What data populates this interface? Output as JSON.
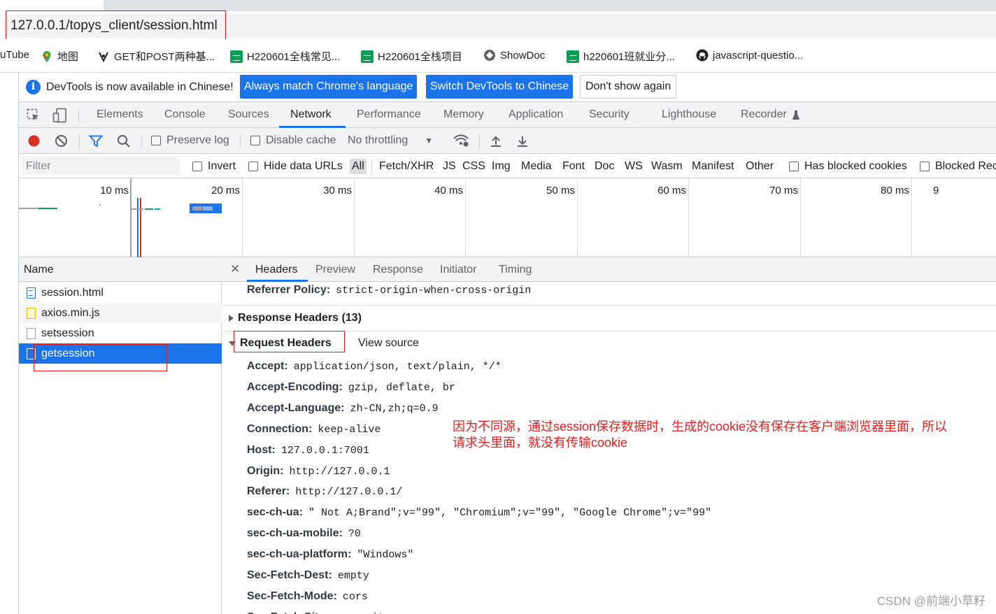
{
  "browser": {
    "url": "127.0.0.1/topys_client/session.html",
    "bookmarks": [
      {
        "label": "uTube",
        "icon": "youtube-icon"
      },
      {
        "label": "地图",
        "icon": "maps-icon"
      },
      {
        "label": "GET和POST两种基...",
        "icon": "bookmark-icon"
      },
      {
        "label": "H220601全栈常见...",
        "icon": "sheet-icon"
      },
      {
        "label": "H220601全栈项目",
        "icon": "sheet-icon"
      },
      {
        "label": "ShowDoc",
        "icon": "showdoc-icon"
      },
      {
        "label": "h220601班就业分...",
        "icon": "sheet-icon"
      },
      {
        "label": "javascript-questio...",
        "icon": "github-icon"
      }
    ]
  },
  "infobar": {
    "message": "DevTools is now available in Chinese!",
    "btn_match": "Always match Chrome's language",
    "btn_switch": "Switch DevTools to Chinese",
    "btn_dismiss": "Don't show again"
  },
  "tabs": [
    "Elements",
    "Console",
    "Sources",
    "Network",
    "Performance",
    "Memory",
    "Application",
    "Security",
    "Lighthouse",
    "Recorder"
  ],
  "active_tab": "Network",
  "toolbar": {
    "preserve_log": "Preserve log",
    "disable_cache": "Disable cache",
    "throttling": "No throttling"
  },
  "filterbar": {
    "placeholder": "Filter",
    "invert": "Invert",
    "hide_data_urls": "Hide data URLs",
    "types": [
      "All",
      "Fetch/XHR",
      "JS",
      "CSS",
      "Img",
      "Media",
      "Font",
      "Doc",
      "WS",
      "Wasm",
      "Manifest",
      "Other"
    ],
    "has_blocked_cookies": "Has blocked cookies",
    "blocked_requests": "Blocked Rec"
  },
  "timeline": {
    "labels": [
      "10 ms",
      "20 ms",
      "30 ms",
      "40 ms",
      "50 ms",
      "60 ms",
      "70 ms",
      "80 ms",
      "9"
    ]
  },
  "requests": {
    "header": "Name",
    "items": [
      {
        "name": "session.html",
        "type": "html"
      },
      {
        "name": "axios.min.js",
        "type": "js"
      },
      {
        "name": "setsession",
        "type": "xhr"
      },
      {
        "name": "getsession",
        "type": "xhr"
      }
    ],
    "selected": "getsession"
  },
  "details": {
    "tabs": [
      "Headers",
      "Preview",
      "Response",
      "Initiator",
      "Timing"
    ],
    "active_tab": "Headers",
    "referrer_policy": {
      "key": "Referrer Policy:",
      "value": "strict-origin-when-cross-origin"
    },
    "response_headers": "Response Headers (13)",
    "request_headers": "Request Headers",
    "view_source": "View source",
    "headers": [
      {
        "key": "Accept:",
        "value": "application/json, text/plain, */*"
      },
      {
        "key": "Accept-Encoding:",
        "value": "gzip, deflate, br"
      },
      {
        "key": "Accept-Language:",
        "value": "zh-CN,zh;q=0.9"
      },
      {
        "key": "Connection:",
        "value": "keep-alive"
      },
      {
        "key": "Host:",
        "value": "127.0.0.1:7001"
      },
      {
        "key": "Origin:",
        "value": "http://127.0.0.1"
      },
      {
        "key": "Referer:",
        "value": "http://127.0.0.1/"
      },
      {
        "key": "sec-ch-ua:",
        "value": "\" Not A;Brand\";v=\"99\", \"Chromium\";v=\"99\", \"Google Chrome\";v=\"99\""
      },
      {
        "key": "sec-ch-ua-mobile:",
        "value": "?0"
      },
      {
        "key": "sec-ch-ua-platform:",
        "value": "\"Windows\""
      },
      {
        "key": "Sec-Fetch-Dest:",
        "value": "empty"
      },
      {
        "key": "Sec-Fetch-Mode:",
        "value": "cors"
      },
      {
        "key": "Sec-Fetch-Site:",
        "value": "same-site"
      }
    ]
  },
  "annotation": {
    "line1": "因为不同源，通过session保存数据时，生成的cookie没有保存在客户端浏览器里面，所以",
    "line2": "请求头里面，就没有传输cookie"
  },
  "watermark": "CSDN @前端小草籽",
  "colors": {
    "accent": "#1a73e8",
    "annotation": "#e02020"
  }
}
